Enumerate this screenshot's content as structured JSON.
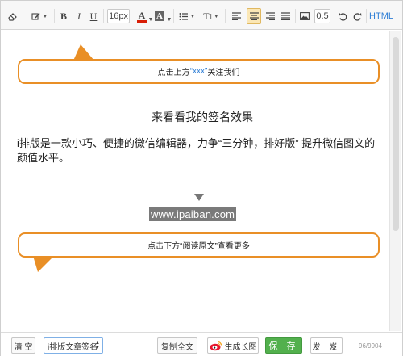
{
  "toolbar": {
    "font_size": "16px",
    "line_height_value": "0.5",
    "html_label": "HTML",
    "bold_label": "B",
    "italic_label": "I",
    "underline_label": "U",
    "font_color_label": "A",
    "bg_color_label": "A",
    "text_size_label": "T",
    "accent_color": "#e0b860"
  },
  "editor": {
    "bubble_top": {
      "prefix": "点击上方",
      "quote": "“xxx”",
      "suffix": "关注我们"
    },
    "signature_title": "来看看我的签名效果",
    "intro_text": "i排版是一款小巧、便捷的微信编辑器，力争“三分钟，排好版” 提升微信图文的颜值水平。",
    "site_link": "www.ipaiban.com",
    "bubble_bottom": "点击下方“阅读原文”查看更多",
    "bubble_border_color": "#e98f26"
  },
  "footer": {
    "clear_label": "清 空",
    "signature_select": "i排版文章签名",
    "copy_label": "复制全文",
    "long_image_label": "生成长图",
    "save_label": "保 存",
    "publish_label": "发 岌",
    "char_count": "96/9904",
    "save_color": "#52b04d"
  }
}
